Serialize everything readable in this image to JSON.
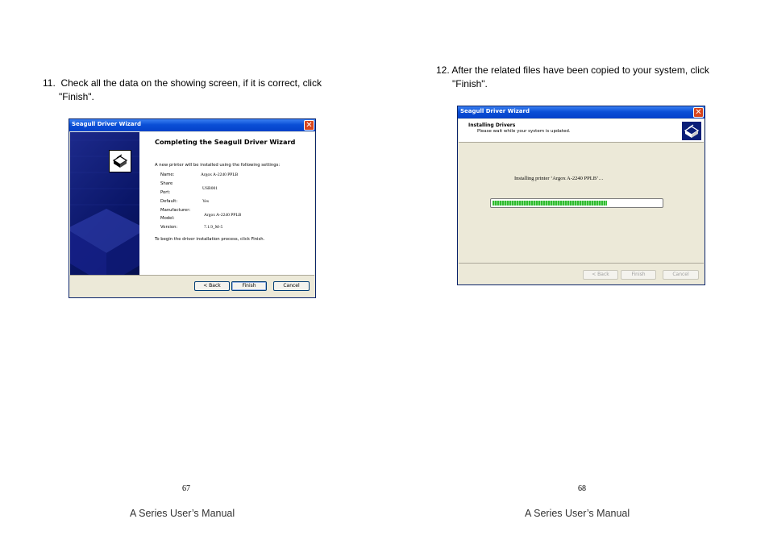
{
  "left_page": {
    "step_number": "11.",
    "step_text_line1": "Check all the data on the showing screen, if it is correct, click",
    "step_text_line2": "\"Finish\".",
    "page_number": "67",
    "footer": "A Series User’s Manual",
    "dialog": {
      "title": "Seagull Driver Wizard",
      "heading": "Completing the Seagull Driver Wizard",
      "intro": "A new printer will be installed using the following settings:",
      "settings": [
        {
          "label": "Name:",
          "value": "Argox A-2240 PPLB"
        },
        {
          "label": "Share",
          "value": "USB001"
        },
        {
          "label": "Port:",
          "value": ""
        },
        {
          "label": "Default:",
          "value": "Yes"
        },
        {
          "label": "Manufacturer:",
          "value": ""
        },
        {
          "label": "Model:",
          "value": "Argox A-2240 PPLB"
        },
        {
          "label": "Version:",
          "value": "7.1.9_M-5"
        }
      ],
      "footer_text": "To begin the driver installation process, click Finish.",
      "buttons": {
        "back": "< Back",
        "finish": "Finish",
        "cancel": "Cancel"
      },
      "icon": "printer-icon"
    }
  },
  "right_page": {
    "step_number": "12.",
    "step_text_line1": "After the related files have been copied to your system, click",
    "step_text_line2": "\"Finish\".",
    "page_number": "68",
    "footer": "A Series User’s Manual",
    "dialog": {
      "title": "Seagull Driver Wizard",
      "header_title": "Installing Drivers",
      "header_subtitle": "Please wait while your system is updated.",
      "status": "Installing printer ‘Argox A-2240 PPLB’…",
      "progress_fraction": 0.68,
      "buttons": {
        "back": "< Back",
        "finish": "Finish",
        "cancel": "Cancel"
      },
      "icon": "printer-icon",
      "progress_color": "#2fbb2f"
    }
  }
}
